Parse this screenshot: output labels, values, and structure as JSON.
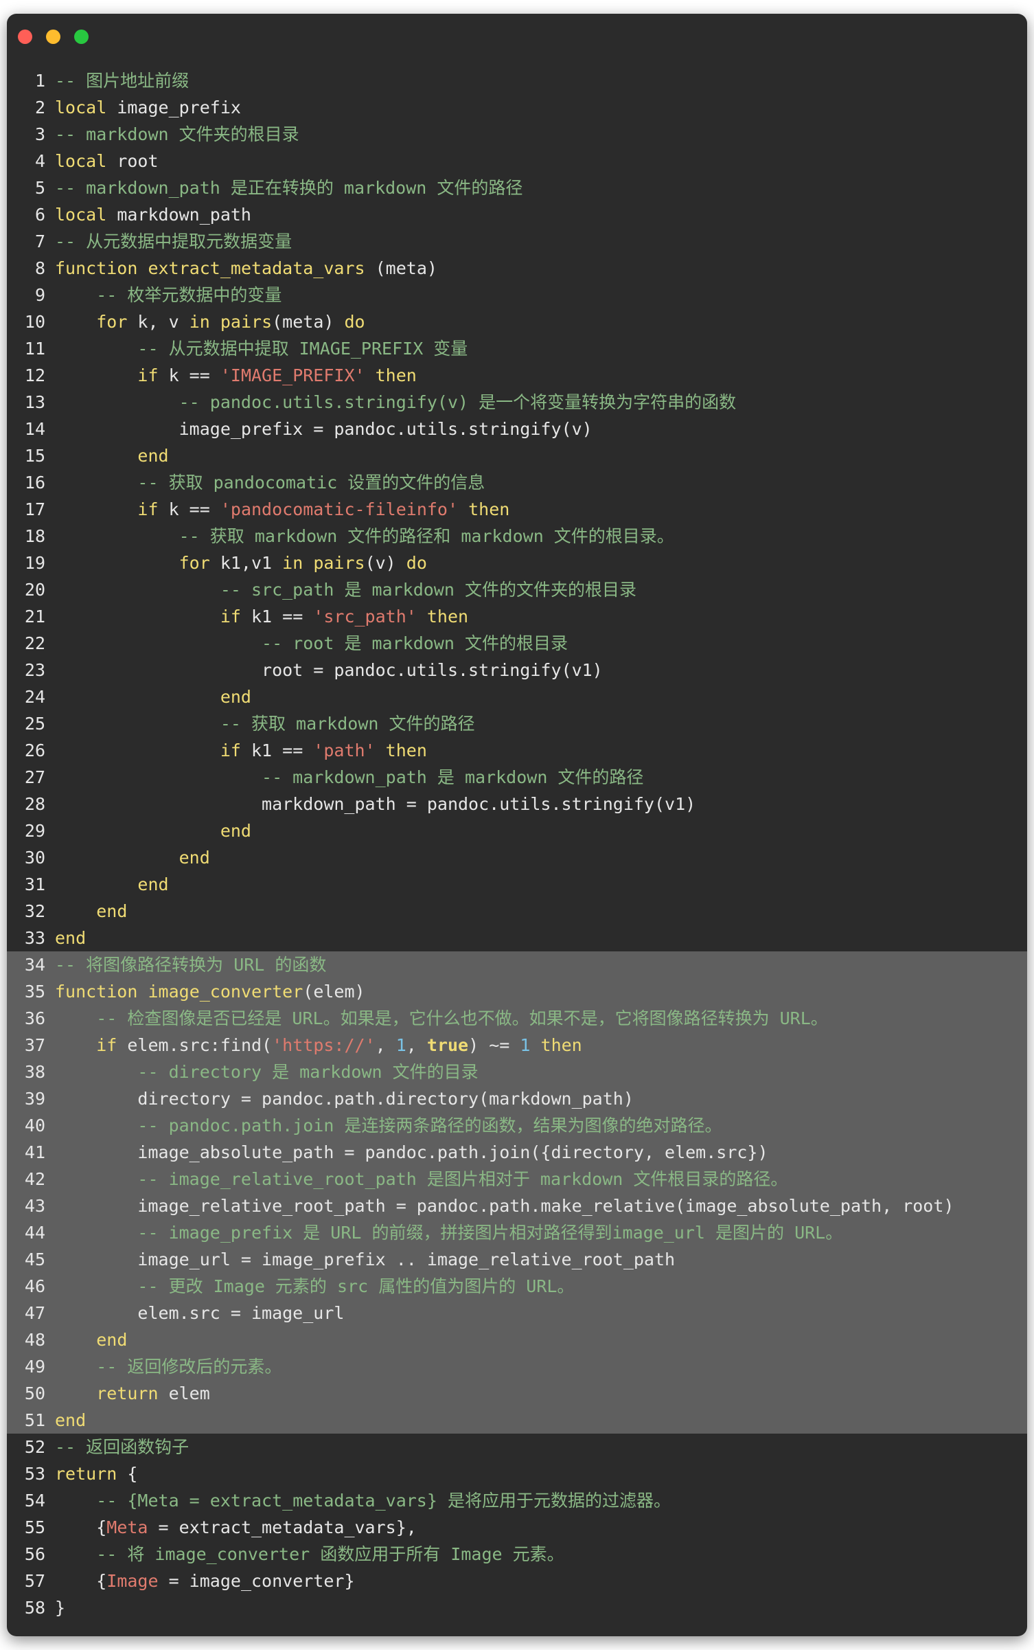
{
  "window": {
    "dots": [
      {
        "name": "close",
        "color": "#ff5f57"
      },
      {
        "name": "minimize",
        "color": "#febc2e"
      },
      {
        "name": "maximize",
        "color": "#28c840"
      }
    ]
  },
  "highlight": {
    "from": 34,
    "to": 51,
    "color": "#5f5f5f"
  },
  "lines": [
    [
      [
        "comment",
        "-- 图片地址前缀"
      ]
    ],
    [
      [
        "keyword",
        "local"
      ],
      [
        "plain",
        " image_prefix"
      ]
    ],
    [
      [
        "comment",
        "-- markdown 文件夹的根目录"
      ]
    ],
    [
      [
        "keyword",
        "local"
      ],
      [
        "plain",
        " root"
      ]
    ],
    [
      [
        "comment",
        "-- markdown_path 是正在转换的 markdown 文件的路径"
      ]
    ],
    [
      [
        "keyword",
        "local"
      ],
      [
        "plain",
        " markdown_path"
      ]
    ],
    [
      [
        "comment",
        "-- 从元数据中提取元数据变量"
      ]
    ],
    [
      [
        "keyword",
        "function"
      ],
      [
        "plain",
        " "
      ],
      [
        "func",
        "extract_metadata_vars"
      ],
      [
        "plain",
        " (meta)"
      ]
    ],
    [
      [
        "plain",
        "    "
      ],
      [
        "comment",
        "-- 枚举元数据中的变量"
      ]
    ],
    [
      [
        "plain",
        "    "
      ],
      [
        "keyword",
        "for"
      ],
      [
        "plain",
        " k, v "
      ],
      [
        "keyword",
        "in"
      ],
      [
        "plain",
        " "
      ],
      [
        "func",
        "pairs"
      ],
      [
        "plain",
        "(meta) "
      ],
      [
        "keyword",
        "do"
      ]
    ],
    [
      [
        "plain",
        "        "
      ],
      [
        "comment",
        "-- 从元数据中提取 IMAGE_PREFIX 变量"
      ]
    ],
    [
      [
        "plain",
        "        "
      ],
      [
        "keyword",
        "if"
      ],
      [
        "plain",
        " k == "
      ],
      [
        "string",
        "'IMAGE_PREFIX'"
      ],
      [
        "plain",
        " "
      ],
      [
        "keyword",
        "then"
      ]
    ],
    [
      [
        "plain",
        "            "
      ],
      [
        "comment",
        "-- pandoc.utils.stringify(v) 是一个将变量转换为字符串的函数"
      ]
    ],
    [
      [
        "plain",
        "            image_prefix = pandoc.utils.stringify(v)"
      ]
    ],
    [
      [
        "plain",
        "        "
      ],
      [
        "keyword",
        "end"
      ]
    ],
    [
      [
        "plain",
        "        "
      ],
      [
        "comment",
        "-- 获取 pandocomatic 设置的文件的信息"
      ]
    ],
    [
      [
        "plain",
        "        "
      ],
      [
        "keyword",
        "if"
      ],
      [
        "plain",
        " k == "
      ],
      [
        "string",
        "'pandocomatic-fileinfo'"
      ],
      [
        "plain",
        " "
      ],
      [
        "keyword",
        "then"
      ]
    ],
    [
      [
        "plain",
        "            "
      ],
      [
        "comment",
        "-- 获取 markdown 文件的路径和 markdown 文件的根目录。"
      ]
    ],
    [
      [
        "plain",
        "            "
      ],
      [
        "keyword",
        "for"
      ],
      [
        "plain",
        " k1,v1 "
      ],
      [
        "keyword",
        "in"
      ],
      [
        "plain",
        " "
      ],
      [
        "func",
        "pairs"
      ],
      [
        "plain",
        "(v) "
      ],
      [
        "keyword",
        "do"
      ]
    ],
    [
      [
        "plain",
        "                "
      ],
      [
        "comment",
        "-- src_path 是 markdown 文件的文件夹的根目录"
      ]
    ],
    [
      [
        "plain",
        "                "
      ],
      [
        "keyword",
        "if"
      ],
      [
        "plain",
        " k1 == "
      ],
      [
        "string",
        "'src_path'"
      ],
      [
        "plain",
        " "
      ],
      [
        "keyword",
        "then"
      ]
    ],
    [
      [
        "plain",
        "                    "
      ],
      [
        "comment",
        "-- root 是 markdown 文件的根目录"
      ]
    ],
    [
      [
        "plain",
        "                    root = pandoc.utils.stringify(v1)"
      ]
    ],
    [
      [
        "plain",
        "                "
      ],
      [
        "keyword",
        "end"
      ]
    ],
    [
      [
        "plain",
        "                "
      ],
      [
        "comment",
        "-- 获取 markdown 文件的路径"
      ]
    ],
    [
      [
        "plain",
        "                "
      ],
      [
        "keyword",
        "if"
      ],
      [
        "plain",
        " k1 == "
      ],
      [
        "string",
        "'path'"
      ],
      [
        "plain",
        " "
      ],
      [
        "keyword",
        "then"
      ]
    ],
    [
      [
        "plain",
        "                    "
      ],
      [
        "comment",
        "-- markdown_path 是 markdown 文件的路径"
      ]
    ],
    [
      [
        "plain",
        "                    markdown_path = pandoc.utils.stringify(v1)"
      ]
    ],
    [
      [
        "plain",
        "                "
      ],
      [
        "keyword",
        "end"
      ]
    ],
    [
      [
        "plain",
        "            "
      ],
      [
        "keyword",
        "end"
      ]
    ],
    [
      [
        "plain",
        "        "
      ],
      [
        "keyword",
        "end"
      ]
    ],
    [
      [
        "plain",
        "    "
      ],
      [
        "keyword",
        "end"
      ]
    ],
    [
      [
        "keyword",
        "end"
      ]
    ],
    [
      [
        "comment",
        "-- 将图像路径转换为 URL 的函数"
      ]
    ],
    [
      [
        "keyword",
        "function"
      ],
      [
        "plain",
        " "
      ],
      [
        "func",
        "image_converter"
      ],
      [
        "plain",
        "(elem)"
      ]
    ],
    [
      [
        "plain",
        "    "
      ],
      [
        "comment",
        "-- 检查图像是否已经是 URL。如果是，它什么也不做。如果不是，它将图像路径转换为 URL。"
      ]
    ],
    [
      [
        "plain",
        "    "
      ],
      [
        "keyword",
        "if"
      ],
      [
        "plain",
        " elem.src:find("
      ],
      [
        "string",
        "'https://'"
      ],
      [
        "plain",
        ", "
      ],
      [
        "number",
        "1"
      ],
      [
        "plain",
        ", "
      ],
      [
        "bool",
        "true"
      ],
      [
        "plain",
        ") ~= "
      ],
      [
        "number",
        "1"
      ],
      [
        "plain",
        " "
      ],
      [
        "keyword",
        "then"
      ]
    ],
    [
      [
        "plain",
        "        "
      ],
      [
        "comment",
        "-- directory 是 markdown 文件的目录"
      ]
    ],
    [
      [
        "plain",
        "        directory = pandoc.path.directory(markdown_path)"
      ]
    ],
    [
      [
        "plain",
        "        "
      ],
      [
        "comment",
        "-- pandoc.path.join 是连接两条路径的函数，结果为图像的绝对路径。"
      ]
    ],
    [
      [
        "plain",
        "        image_absolute_path = pandoc.path.join({directory, elem.src})"
      ]
    ],
    [
      [
        "plain",
        "        "
      ],
      [
        "comment",
        "-- image_relative_root_path 是图片相对于 markdown 文件根目录的路径。"
      ]
    ],
    [
      [
        "plain",
        "        image_relative_root_path = pandoc.path.make_relative(image_absolute_path, root)"
      ]
    ],
    [
      [
        "plain",
        "        "
      ],
      [
        "comment",
        "-- image_prefix 是 URL 的前缀，拼接图片相对路径得到image_url 是图片的 URL。"
      ]
    ],
    [
      [
        "plain",
        "        image_url = image_prefix .. image_relative_root_path"
      ]
    ],
    [
      [
        "plain",
        "        "
      ],
      [
        "comment",
        "-- 更改 Image 元素的 src 属性的值为图片的 URL。"
      ]
    ],
    [
      [
        "plain",
        "        elem.src = image_url"
      ]
    ],
    [
      [
        "plain",
        "    "
      ],
      [
        "keyword",
        "end"
      ]
    ],
    [
      [
        "plain",
        "    "
      ],
      [
        "comment",
        "-- 返回修改后的元素。"
      ]
    ],
    [
      [
        "plain",
        "    "
      ],
      [
        "keyword",
        "return"
      ],
      [
        "plain",
        " elem"
      ]
    ],
    [
      [
        "keyword",
        "end"
      ]
    ],
    [
      [
        "comment",
        "-- 返回函数钩子"
      ]
    ],
    [
      [
        "keyword",
        "return"
      ],
      [
        "plain",
        " {"
      ]
    ],
    [
      [
        "plain",
        "    "
      ],
      [
        "comment",
        "-- {Meta = extract_metadata_vars} 是将应用于元数据的过滤器。"
      ]
    ],
    [
      [
        "plain",
        "    {"
      ],
      [
        "field",
        "Meta"
      ],
      [
        "plain",
        " = extract_metadata_vars},"
      ]
    ],
    [
      [
        "plain",
        "    "
      ],
      [
        "comment",
        "-- 将 image_converter 函数应用于所有 Image 元素。"
      ]
    ],
    [
      [
        "plain",
        "    {"
      ],
      [
        "field",
        "Image"
      ],
      [
        "plain",
        " = image_converter}"
      ]
    ],
    [
      [
        "plain",
        "}"
      ]
    ]
  ]
}
